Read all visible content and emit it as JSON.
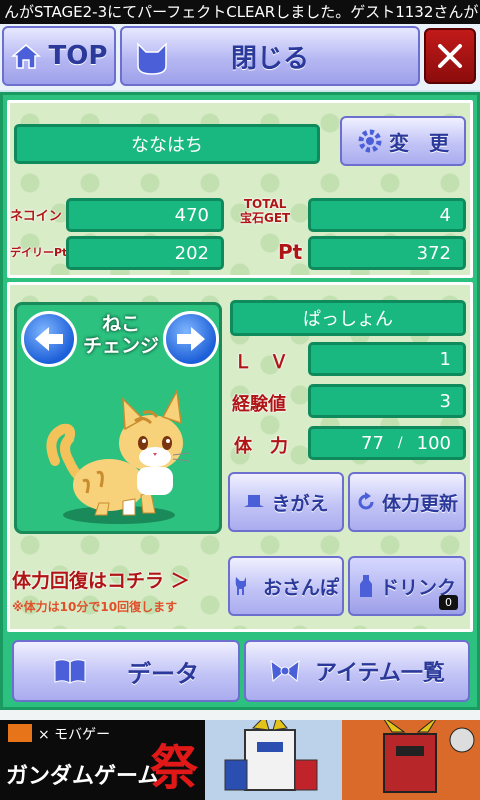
{
  "ticker": "んがSTAGE2-3にてパーフェクトCLEARしました。ゲスト1132さんが",
  "topbar": {
    "top_label": "TOP",
    "close_label": "閉じる"
  },
  "profile": {
    "name": "ななはち",
    "change_label": "変　更",
    "neko_coin_label": "ネコイン",
    "neko_coin": "470",
    "total_label": "TOTAL\n宝石GET",
    "total": "4",
    "daily_pt_label": "デイリーPt",
    "daily_pt": "202",
    "pt_label": "Pt",
    "pt": "372"
  },
  "cat": {
    "change_label": "ねこ\nチェンジ",
    "name": "ぱっしょん",
    "lv_label": "Ｌ　Ｖ",
    "lv": "1",
    "exp_label": "経験値",
    "exp": "3",
    "hp_label": "体　力",
    "hp_current": "77",
    "hp_sep": "/",
    "hp_max": "100"
  },
  "actions": {
    "kigae_label": "きがえ",
    "hp_update_label": "体力更新",
    "recover_text": "体力回復はコチラ ＞",
    "recover_note": "※体力は10分で10回復します",
    "osanpo_label": "おさんぽ",
    "drink_label": "ドリンク",
    "drink_count": "0"
  },
  "bottom": {
    "data_label": "データ",
    "items_label": "アイテム一覧"
  },
  "ad": {
    "brand": "× モバゲー",
    "title": "ガンダムゲーム",
    "kanji": "祭"
  },
  "colors": {
    "panel_green": "#2cc17f",
    "field_green": "#18b880",
    "label_red": "#b01515",
    "button_blue": "#2b3a9a"
  }
}
